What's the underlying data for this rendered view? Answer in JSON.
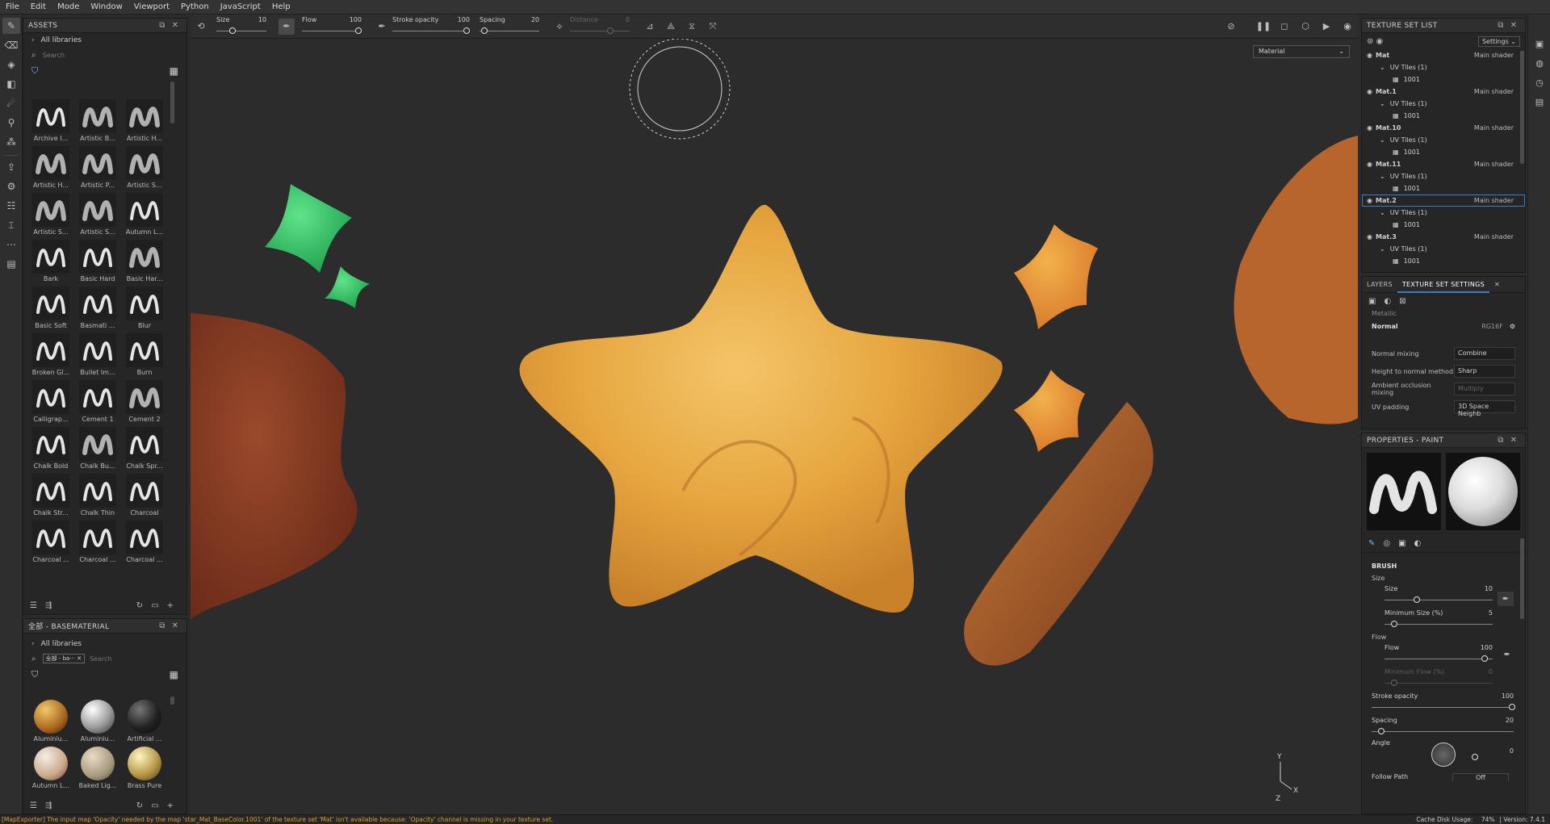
{
  "menu": [
    "File",
    "Edit",
    "Mode",
    "Window",
    "Viewport",
    "Python",
    "JavaScript",
    "Help"
  ],
  "assets": {
    "title": "ASSETS",
    "library": "All libraries",
    "search_placeholder": "Search",
    "brushes": [
      "Archive I...",
      "Artistic B...",
      "Artistic H...",
      "Artistic H...",
      "Artistic P...",
      "Artistic S...",
      "Artistic S...",
      "Artistic S...",
      "Autumn L...",
      "Bark",
      "Basic Hard",
      "Basic Har...",
      "Basic Soft",
      "Basmati ...",
      "Blur",
      "Broken Gl...",
      "Bullet Im...",
      "Burn",
      "Calligrap...",
      "Cement 1",
      "Cement 2",
      "Chalk Bold",
      "Chalk Bu...",
      "Chalk Spr...",
      "Chalk Str...",
      "Chalk Thin",
      "Charcoal",
      "Charcoal ...",
      "Charcoal ...",
      "Charcoal ..."
    ]
  },
  "basematerial": {
    "title": "全部 - BASEMATERIAL",
    "library": "All libraries",
    "chip": "全部 - ba···",
    "search_placeholder": "Search",
    "materials": [
      "Aluminiu...",
      "Aluminiu...",
      "Artificial ...",
      "Autumn L...",
      "Baked Lig...",
      "Brass Pure"
    ]
  },
  "toolbar": {
    "size_label": "Size",
    "size_value": "10",
    "flow_label": "Flow",
    "flow_value": "100",
    "opacity_label": "Stroke opacity",
    "opacity_value": "100",
    "spacing_label": "Spacing",
    "spacing_value": "20",
    "distance_label": "Distance",
    "distance_value": "0"
  },
  "viewport": {
    "material_mode": "Material"
  },
  "texture_set_list": {
    "title": "TEXTURE SET LIST",
    "settings_label": "Settings",
    "sets": [
      {
        "name": "Mat",
        "shader": "Main shader",
        "uv": "UV Tiles (1)",
        "tile": "1001"
      },
      {
        "name": "Mat.1",
        "shader": "Main shader",
        "uv": "UV Tiles (1)",
        "tile": "1001"
      },
      {
        "name": "Mat.10",
        "shader": "Main shader",
        "uv": "UV Tiles (1)",
        "tile": "1001"
      },
      {
        "name": "Mat.11",
        "shader": "Main shader",
        "uv": "UV Tiles (1)",
        "tile": "1001"
      },
      {
        "name": "Mat.2",
        "shader": "Main shader",
        "uv": "UV Tiles (1)",
        "tile": "1001"
      },
      {
        "name": "Mat.3",
        "shader": "Main shader",
        "uv": "UV Tiles (1)",
        "tile": "1001"
      }
    ]
  },
  "texture_set_settings": {
    "tab_layers": "LAYERS",
    "tab_settings": "TEXTURE SET SETTINGS",
    "partial": "Metallic",
    "normal_label": "Normal",
    "normal_format": "RG16F",
    "rows": [
      {
        "key": "Normal mixing",
        "value": "Combine"
      },
      {
        "key": "Height to normal method",
        "value": "Sharp"
      },
      {
        "key": "Ambient occlusion mixing",
        "value": "Multiply"
      },
      {
        "key": "UV padding",
        "value": "3D Space Neighb"
      }
    ]
  },
  "properties": {
    "title": "PROPERTIES - PAINT",
    "section": "BRUSH",
    "size_group": "Size",
    "size_label": "Size",
    "size_value": "10",
    "min_size_label": "Minimum Size (%)",
    "min_size_value": "5",
    "flow_group": "Flow",
    "flow_label": "Flow",
    "flow_value": "100",
    "min_flow_label": "Minimum Flow (%)",
    "min_flow_value": "0",
    "opacity_label": "Stroke opacity",
    "opacity_value": "100",
    "spacing_label": "Spacing",
    "spacing_value": "20",
    "angle_label": "Angle",
    "angle_value": "0",
    "follow_path_label": "Follow Path",
    "follow_path_value": "Off"
  },
  "status": {
    "message": "[MapExporter] The input map 'Opacity' needed by the map 'star_Mat_BaseColor.1001' of the texture set 'Mat' isn't available because: 'Opacity' channel is missing in your texture set.",
    "cache": "Cache Disk Usage:",
    "cache_value": "74%",
    "version": "Version: 7.4.1"
  },
  "colors": {
    "accent": "#3a7bd5",
    "warning": "#e0a030"
  }
}
